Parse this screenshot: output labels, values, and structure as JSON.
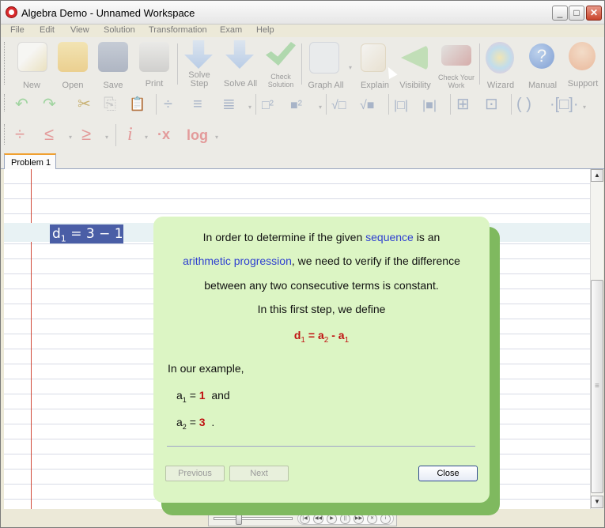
{
  "window": {
    "title": "Algebra Demo - Unnamed Workspace",
    "controls": {
      "minimize": "_",
      "maximize": "□",
      "close": "✕"
    }
  },
  "menu": [
    "File",
    "Edit",
    "View",
    "Solution",
    "Transformation",
    "Exam",
    "Help"
  ],
  "toolbar": {
    "main": [
      {
        "name": "new",
        "label": "New",
        "icon": "new-document-icon"
      },
      {
        "name": "open",
        "label": "Open",
        "icon": "folder-icon"
      },
      {
        "name": "save",
        "label": "Save",
        "icon": "floppy-disk-icon"
      },
      {
        "name": "print",
        "label": "Print",
        "icon": "printer-icon"
      },
      {
        "name": "solve-step",
        "label": "Solve Step",
        "icon": "down-arrow-icon"
      },
      {
        "name": "solve-all",
        "label": "Solve All",
        "icon": "double-down-arrow-icon"
      },
      {
        "name": "check-solution",
        "label": "Check Solution",
        "icon": "checkmark-icon"
      },
      {
        "name": "graph-all",
        "label": "Graph All",
        "icon": "graph-icon"
      },
      {
        "name": "explain",
        "label": "Explain",
        "icon": "explain-document-icon"
      },
      {
        "name": "visibility",
        "label": "Visibility",
        "icon": "visibility-icon"
      },
      {
        "name": "check-your-work",
        "label": "Check Your Work",
        "icon": "magic-wand-icon"
      },
      {
        "name": "wizard",
        "label": "Wizard",
        "icon": "wizard-icon"
      },
      {
        "name": "manual",
        "label": "Manual",
        "icon": "help-icon"
      },
      {
        "name": "support",
        "label": "Support",
        "icon": "support-person-icon"
      }
    ],
    "row2_symbols": [
      "↶",
      "↷",
      "✂",
      "⎘",
      "📋",
      "÷",
      "≡",
      "≣",
      "□²",
      "■²",
      "√□",
      "√■",
      "|□|",
      "|■|",
      "⊞",
      "⊡",
      "( )",
      "·[□]·"
    ],
    "row3_symbols": [
      "÷",
      "≤",
      "≥",
      "i",
      "·x",
      "log"
    ]
  },
  "tabs": [
    {
      "label": "Problem 1"
    }
  ],
  "workspace": {
    "expression": {
      "lhs": "d",
      "sub": "1",
      "rhs": " = 3 − 1"
    }
  },
  "explanation": {
    "line1_pre": "In order to determine if the given ",
    "line1_link": "sequence",
    "line1_post": " is an",
    "line2_link": "arithmetic progression",
    "line2_post": ", we need to verify if the difference",
    "line3": "between any two consecutive terms is constant.",
    "line4": "In this first step, we define",
    "formula": {
      "a": "d",
      "a_sub": "1",
      "eq": " = ",
      "b": "a",
      "b_sub": "2",
      "minus": " - ",
      "c": "a",
      "c_sub": "1"
    },
    "example_intro": "In our example,",
    "a1": {
      "label": "a",
      "sub": "1",
      "eq": " =  ",
      "value": "1",
      "suffix": "and"
    },
    "a2": {
      "label": "a",
      "sub": "2",
      "eq": " =  ",
      "value": "3",
      "suffix": "."
    },
    "buttons": {
      "previous": "Previous",
      "next": "Next",
      "close": "Close"
    }
  },
  "player": {
    "position_fraction": 0.3
  },
  "colors": {
    "accent": "#4a5ea6",
    "popup_bg": "#dcf5c4",
    "popup_shadow": "#7fb95f",
    "formula_red": "#c01212",
    "link_blue": "#2e3fd0"
  }
}
